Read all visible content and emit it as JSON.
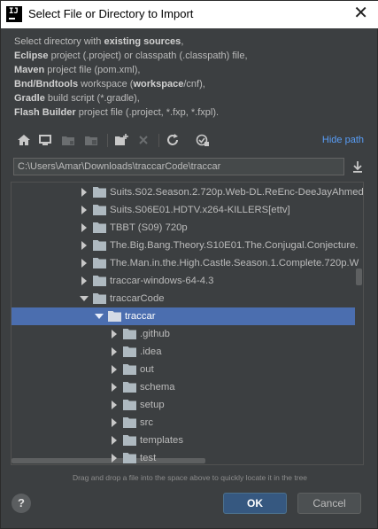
{
  "window": {
    "title": "Select File or Directory to Import",
    "app_icon_text": "IJ"
  },
  "description": {
    "lines": [
      {
        "bold": "",
        "pre": "Select directory with ",
        "strong": "existing sources",
        "post": ","
      },
      {
        "pre": "",
        "strong": "Eclipse",
        "post": " project (.project) or classpath (.classpath) file,"
      },
      {
        "pre": "",
        "strong": "Maven",
        "post": " project file (pom.xml),"
      },
      {
        "pre": "",
        "strong": "Bnd/Bndtools",
        "post": " workspace (",
        "strong2": "workspace",
        "post2": "/cnf),"
      },
      {
        "pre": "",
        "strong": "Gradle",
        "post": " build script (*.gradle),"
      },
      {
        "pre": "",
        "strong": "Flash Builder",
        "post": " project file (.project, *.fxp, *.fxpl)."
      }
    ]
  },
  "toolbar": {
    "buttons": [
      "home-icon",
      "desktop-icon",
      "project-folder-icon",
      "module-folder-icon",
      "new-folder-icon",
      "delete-icon",
      "refresh-icon",
      "show-hidden-icon"
    ],
    "hide_path_label": "Hide path"
  },
  "path": {
    "value": "C:\\Users\\Amar\\Downloads\\traccarCode\\traccar"
  },
  "tree": {
    "rows": [
      {
        "label": "Suits.S02.Season.2.720p.Web-DL.ReEnc-DeeJayAhmed",
        "depth": 0,
        "expanded": false
      },
      {
        "label": "Suits.S06E01.HDTV.x264-KILLERS[ettv]",
        "depth": 0,
        "expanded": false
      },
      {
        "label": "TBBT (S09) 720p",
        "depth": 0,
        "expanded": false
      },
      {
        "label": "The.Big.Bang.Theory.S10E01.The.Conjugal.Conjecture.",
        "depth": 0,
        "expanded": false
      },
      {
        "label": "The.Man.in.the.High.Castle.Season.1.Complete.720p.W",
        "depth": 0,
        "expanded": false
      },
      {
        "label": "traccar-windows-64-4.3",
        "depth": 0,
        "expanded": false
      },
      {
        "label": "traccarCode",
        "depth": 0,
        "expanded": true
      },
      {
        "label": "traccar",
        "depth": 1,
        "expanded": true,
        "selected": true
      },
      {
        "label": ".github",
        "depth": 2,
        "expanded": false
      },
      {
        "label": ".idea",
        "depth": 2,
        "expanded": false
      },
      {
        "label": "out",
        "depth": 2,
        "expanded": false
      },
      {
        "label": "schema",
        "depth": 2,
        "expanded": false
      },
      {
        "label": "setup",
        "depth": 2,
        "expanded": false
      },
      {
        "label": "src",
        "depth": 2,
        "expanded": false
      },
      {
        "label": "templates",
        "depth": 2,
        "expanded": false
      },
      {
        "label": "test",
        "depth": 2,
        "expanded": false
      }
    ]
  },
  "hint": "Drag and drop a file into the space above to quickly locate it in the tree",
  "footer": {
    "help_label": "?",
    "ok_label": "OK",
    "cancel_label": "Cancel"
  },
  "colors": {
    "background": "#3c3f41",
    "selection": "#4b6eaf",
    "link": "#589df6",
    "ok_button": "#365880"
  }
}
